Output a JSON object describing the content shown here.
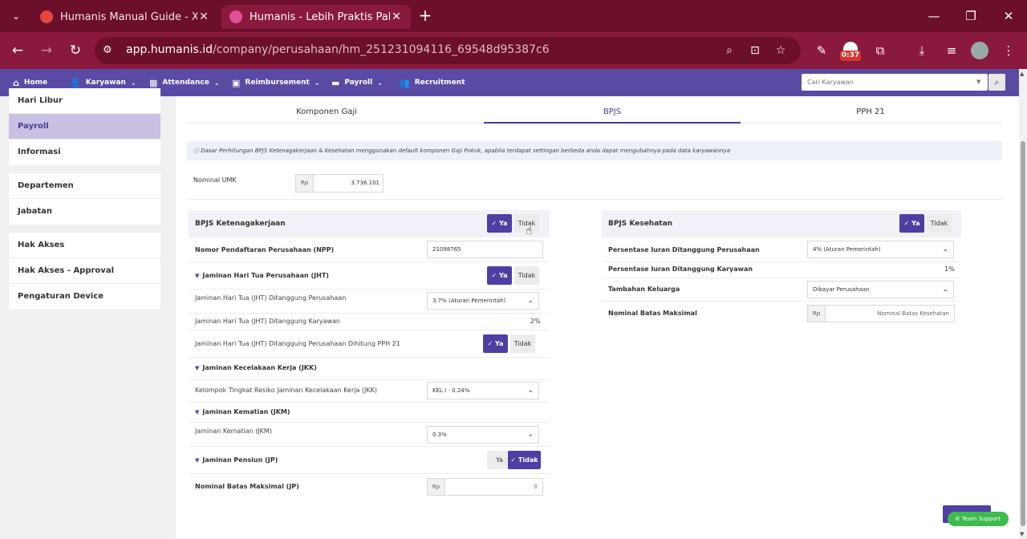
{
  "browser": {
    "tabs": [
      {
        "title": "Humanis Manual Guide - Xmind",
        "active": false
      },
      {
        "title": "Humanis - Lebih Praktis Pakai Humanis",
        "active": true
      }
    ],
    "url_host": "app.humanis.id",
    "url_path": "/company/perusahaan/hm_251231094116_69548d95387c6",
    "extension_timer": "0:37"
  },
  "nav": {
    "items": [
      {
        "label": "Home",
        "icon": "home-icon"
      },
      {
        "label": "Karyawan",
        "icon": "user-edit-icon"
      },
      {
        "label": "Attendance",
        "icon": "calendar-icon"
      },
      {
        "label": "Reimbursement",
        "icon": "money-icon"
      },
      {
        "label": "Payroll",
        "icon": "folder-icon"
      },
      {
        "label": "Recruitment",
        "icon": "users-icon"
      }
    ],
    "search_placeholder": "Cari Karyawan"
  },
  "sidebar": {
    "group1": [
      "Hari Libur",
      "Payroll",
      "Informasi"
    ],
    "group2": [
      "Departemen",
      "Jabatan"
    ],
    "group3": [
      "Hak Akses",
      "Hak Akses - Approval",
      "Pengaturan Device"
    ],
    "active": "Payroll"
  },
  "subtabs": [
    "Komponen Gaji",
    "BPJS",
    "PPH 21"
  ],
  "active_subtab": "BPJS",
  "info_text": "Dasar Perhitungan BPJS Ketenagakerjaan & Kesehatan menggunakan default komponen Gaji Pokok, apabila terdapat settingan berbeda anda dapat mengubahnya pada data karyawannya",
  "umk": {
    "label": "Nominal UMK",
    "currency": "Rp",
    "value": "3.736.101"
  },
  "buttons": {
    "ya": "Ya",
    "tidak": "Tidak"
  },
  "ketenagakerjaan": {
    "title": "BPJS Ketenagakerjaan",
    "npp_label": "Nomor Pendaftaran Perusahaan (NPP)",
    "npp_value": "21098765",
    "jht_title": "Jaminan Hari Tua Perusahaan (JHT)",
    "jht_perusahaan_label": "Jaminan Hari Tua (JHT) Ditanggung Perusahaan",
    "jht_perusahaan_value": "3.7% (Aturan Pemerintah)",
    "jht_karyawan_label": "Jaminan Hari Tua (JHT) Ditanggung Karyawan",
    "jht_karyawan_value": "2%",
    "jht_pph_label": "Jaminan Hari Tua (JHT) Ditanggung Perusahaan Dihitung PPH 21",
    "jkk_title": "Jaminan Kecelakaan Kerja (JKK)",
    "jkk_label": "Kelompok Tingkat Resiko Jaminan Kecelakaan Kerja (JKK)",
    "jkk_value": "KEL I - 0.24%",
    "jkm_title": "Jaminan Kematian (JKM)",
    "jkm_label": "Jaminan Kematian (JKM)",
    "jkm_value": "0.3%",
    "jp_title": "Jaminan Pensiun (JP)",
    "jp_max_label": "Nominal Batas Maksimal (JP)",
    "jp_max_currency": "Rp",
    "jp_max_value": "0"
  },
  "kesehatan": {
    "title": "BPJS Kesehatan",
    "iuran_perusahaan_label": "Persentase Iuran Ditanggung Perusahaan",
    "iuran_perusahaan_value": "4% (Aturan Pemerintah)",
    "iuran_karyawan_label": "Persentase Iuran Ditanggung Karyawan",
    "iuran_karyawan_value": "1%",
    "keluarga_label": "Tambahan Keluarga",
    "keluarga_value": "Dibayar Perusahaan",
    "max_label": "Nominal Batas Maksimal",
    "max_currency": "Rp",
    "max_placeholder": "Nominal Batas Kesehatan"
  },
  "support_label": "Team Support"
}
